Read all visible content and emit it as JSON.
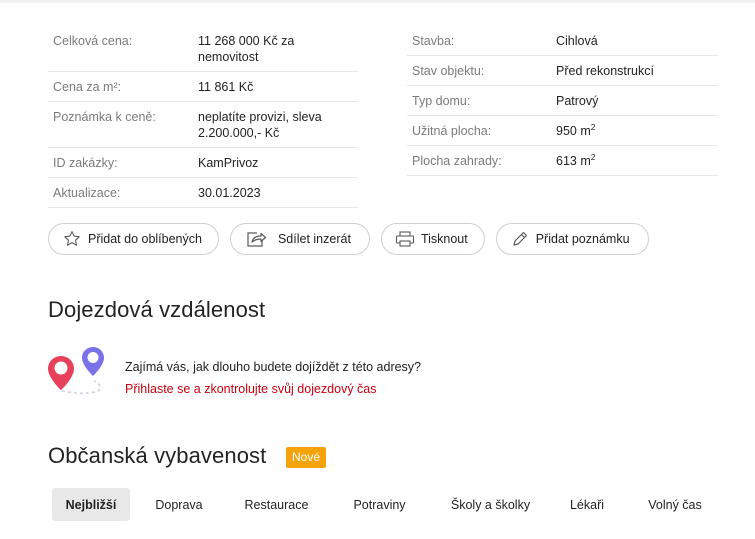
{
  "params_left": [
    {
      "label": "Celková cena:",
      "value": "11 268 000 Kč za nemovitost"
    },
    {
      "label": "Cena za m²:",
      "value": "11 861 Kč"
    },
    {
      "label": "Poznámka k ceně:",
      "value": "neplatíte provizi, sleva 2.200.000,- Kč"
    },
    {
      "label": "ID zakázky:",
      "value": "KamPrivoz"
    },
    {
      "label": "Aktualizace:",
      "value": "30.01.2023"
    }
  ],
  "params_right": [
    {
      "label": "Stavba:",
      "value": "Cihlová"
    },
    {
      "label": "Stav objektu:",
      "value": "Před rekonstrukcí"
    },
    {
      "label": "Typ domu:",
      "value": "Patrový"
    },
    {
      "label": "Užitná plocha:",
      "value": "950 m",
      "sup": "2"
    },
    {
      "label": "Plocha zahrady:",
      "value": "613 m",
      "sup": "2"
    }
  ],
  "actions": {
    "favorite": "Přidat do oblíbených",
    "share": "Sdílet inzerát",
    "print": "Tisknout",
    "note": "Přidat poznámku"
  },
  "commute": {
    "title": "Dojezdová vzdálenost",
    "question": "Zajímá vás, jak dlouho budete dojíždět z této adresy?",
    "login_link": "Přihlaste se a zkontrolujte svůj dojezdový čas"
  },
  "civic": {
    "title": "Občanská vybavenost",
    "badge": "Nové",
    "tabs": [
      "Nejbližší",
      "Doprava",
      "Restaurace",
      "Potraviny",
      "Školy a školky",
      "Lékaři",
      "Volný čas"
    ],
    "active_tab": "Nejbližší"
  },
  "colors": {
    "link_red": "#c9000e",
    "badge_orange": "#f5a30a",
    "pin_red": "#e8405a",
    "pin_purple": "#7b72e9"
  }
}
